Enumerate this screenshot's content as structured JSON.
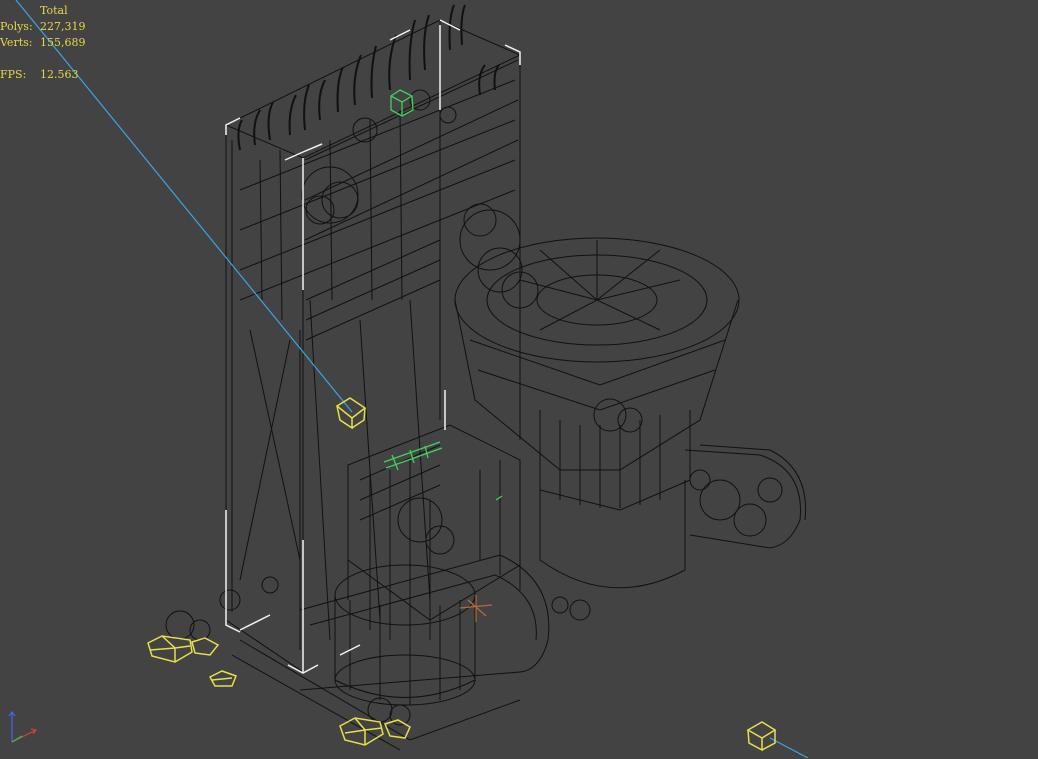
{
  "viewport": {
    "stats": {
      "header": "Total",
      "polys_label": "Polys:",
      "polys_value": "227,319",
      "verts_label": "Verts:",
      "verts_value": "155,689",
      "fps_label": "FPS:",
      "fps_value": "12.563"
    },
    "colors": {
      "background": "#434343",
      "wire": "#111111",
      "wire_highlight": "#f2f2f2",
      "selected_yellow": "#e6e04a",
      "selected_green": "#43d15a",
      "camera_line": "#3aa4e6",
      "pivot": "#b86a3a"
    },
    "icons": {
      "axis_gizmo": "axis-tripod-icon",
      "camera": "camera-box-icon",
      "light": "light-box-icon"
    }
  }
}
